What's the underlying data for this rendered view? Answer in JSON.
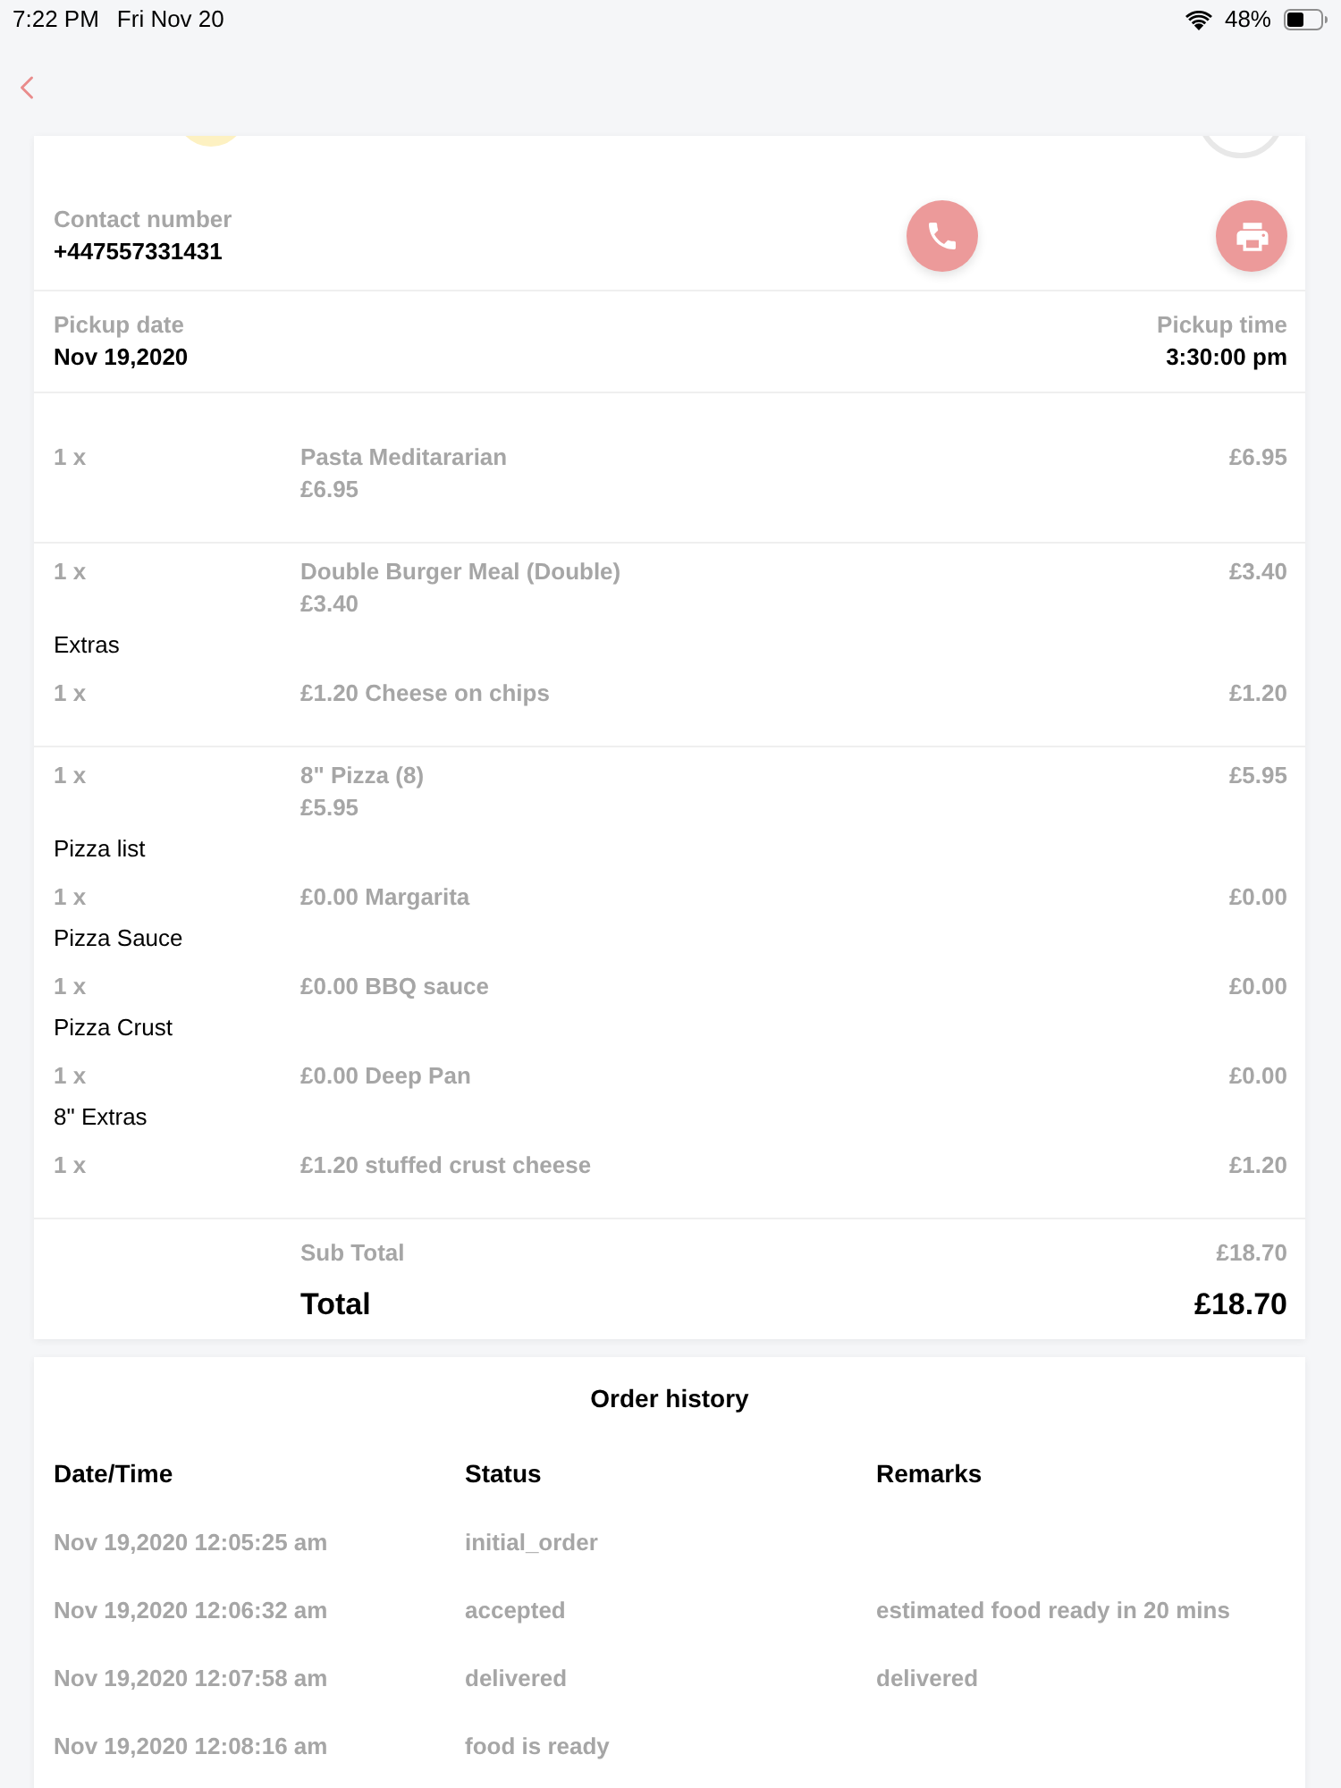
{
  "status_bar": {
    "time": "7:22 PM",
    "date": "Fri Nov 20",
    "battery": "48%"
  },
  "contact": {
    "label": "Contact number",
    "number": "+447557331431"
  },
  "pickup": {
    "date_label": "Pickup date",
    "date": "Nov 19,2020",
    "time_label": "Pickup time",
    "time": "3:30:00 pm"
  },
  "items": [
    {
      "quantity": "1 x",
      "name": "Pasta Meditararian",
      "unit_price": "£6.95",
      "price": "£6.95"
    },
    {
      "quantity": "1 x",
      "name": "Double Burger Meal (Double)",
      "unit_price": "£3.40",
      "price": "£3.40",
      "option_groups": [
        {
          "title": "Extras",
          "options": [
            {
              "quantity": "1 x",
              "name": "£1.20 Cheese on chips",
              "price": "£1.20"
            }
          ]
        }
      ]
    },
    {
      "quantity": "1 x",
      "name": "8\" Pizza (8)",
      "unit_price": "£5.95",
      "price": "£5.95",
      "option_groups": [
        {
          "title": "Pizza list",
          "options": [
            {
              "quantity": "1 x",
              "name": "£0.00 Margarita",
              "price": "£0.00"
            }
          ]
        },
        {
          "title": "Pizza Sauce",
          "options": [
            {
              "quantity": "1 x",
              "name": "£0.00 BBQ sauce",
              "price": "£0.00"
            }
          ]
        },
        {
          "title": "Pizza Crust",
          "options": [
            {
              "quantity": "1 x",
              "name": "£0.00 Deep Pan",
              "price": "£0.00"
            }
          ]
        },
        {
          "title": "8\" Extras",
          "options": [
            {
              "quantity": "1 x",
              "name": "£1.20 stuffed crust cheese",
              "price": "£1.20"
            }
          ]
        }
      ]
    }
  ],
  "totals": {
    "subtotal_label": "Sub Total",
    "subtotal": "£18.70",
    "total_label": "Total",
    "total": "£18.70"
  },
  "order_history": {
    "title": "Order history",
    "columns": [
      "Date/Time",
      "Status",
      "Remarks"
    ],
    "rows": [
      {
        "datetime": "Nov 19,2020 12:05:25 am",
        "status": "initial_order"
      },
      {
        "datetime": "Nov 19,2020 12:06:32 am",
        "status": "accepted",
        "remarks": "estimated food ready in 20 mins"
      },
      {
        "datetime": "Nov 19,2020 12:07:58 am",
        "status": "delivered",
        "remarks": "delivered"
      },
      {
        "datetime": "Nov 19,2020 12:08:16 am",
        "status": "food is ready"
      }
    ]
  }
}
